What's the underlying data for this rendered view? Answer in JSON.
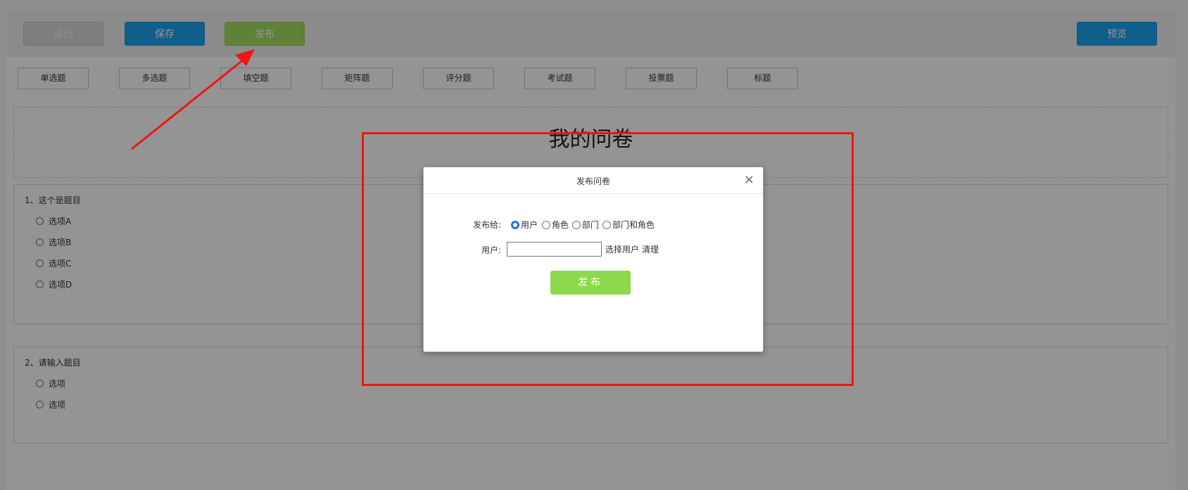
{
  "toolbar": {
    "back_label": "返回",
    "save_label": "保存",
    "publish_label": "发布",
    "preview_label": "预览"
  },
  "question_types": [
    "单选题",
    "多选题",
    "填空题",
    "矩阵题",
    "评分题",
    "考试题",
    "投票题",
    "标题"
  ],
  "survey": {
    "title": "我的问卷",
    "questions": [
      {
        "title": "1、这个是题目",
        "options": [
          "选项A",
          "选项B",
          "选项C",
          "选项D"
        ]
      },
      {
        "title": "2、请输入题目",
        "options": [
          "选项",
          "选项"
        ]
      }
    ]
  },
  "dialog": {
    "title": "发布问卷",
    "close_glyph": "×",
    "publish_to_label": "发布给:",
    "targets": [
      {
        "label": "用户",
        "checked": true
      },
      {
        "label": "角色",
        "checked": false
      },
      {
        "label": "部门",
        "checked": false
      },
      {
        "label": "部门和角色",
        "checked": false
      }
    ],
    "user_label": "用户:",
    "user_value": "",
    "select_user_link": "选择用户",
    "clear_link": "清理",
    "submit_label": "发布"
  },
  "colors": {
    "primary_blue": "#1aa3f2",
    "publish_green": "#8cd94b",
    "annotation_red": "#f01414"
  }
}
